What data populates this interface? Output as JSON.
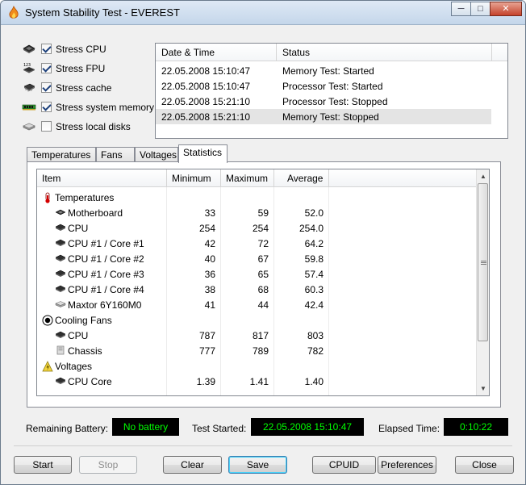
{
  "window": {
    "title": "System Stability Test - EVEREST",
    "min_label": "─",
    "max_label": "□",
    "close_label": "✕"
  },
  "stress": [
    {
      "label": "Stress CPU",
      "checked": true,
      "icon": "cpu-chip-icon"
    },
    {
      "label": "Stress FPU",
      "checked": true,
      "icon": "fpu-chip-icon"
    },
    {
      "label": "Stress cache",
      "checked": true,
      "icon": "cache-chip-icon"
    },
    {
      "label": "Stress system memory",
      "checked": true,
      "icon": "memory-module-icon"
    },
    {
      "label": "Stress local disks",
      "checked": false,
      "icon": "hard-disk-icon"
    }
  ],
  "log": {
    "columns": [
      "Date & Time",
      "Status"
    ],
    "rows": [
      [
        "22.05.2008 15:10:47",
        "Memory Test: Started"
      ],
      [
        "22.05.2008 15:10:47",
        "Processor Test: Started"
      ],
      [
        "22.05.2008 15:21:10",
        "Processor Test: Stopped"
      ],
      [
        "22.05.2008 15:21:10",
        "Memory Test: Stopped"
      ]
    ]
  },
  "tabs": [
    "Temperatures",
    "Fans",
    "Voltages",
    "Statistics"
  ],
  "active_tab": "Statistics",
  "stats": {
    "columns": [
      "Item",
      "Minimum",
      "Maximum",
      "Average"
    ],
    "rows": [
      {
        "type": "group",
        "icon": "thermometer-icon",
        "item": "Temperatures"
      },
      {
        "type": "item",
        "icon": "motherboard-icon",
        "item": "Motherboard",
        "min": "33",
        "max": "59",
        "avg": "52.0"
      },
      {
        "type": "item",
        "icon": "cpu-icon",
        "item": "CPU",
        "min": "254",
        "max": "254",
        "avg": "254.0"
      },
      {
        "type": "item",
        "icon": "cpu-icon",
        "item": "CPU #1 / Core #1",
        "min": "42",
        "max": "72",
        "avg": "64.2"
      },
      {
        "type": "item",
        "icon": "cpu-icon",
        "item": "CPU #1 / Core #2",
        "min": "40",
        "max": "67",
        "avg": "59.8"
      },
      {
        "type": "item",
        "icon": "cpu-icon",
        "item": "CPU #1 / Core #3",
        "min": "36",
        "max": "65",
        "avg": "57.4"
      },
      {
        "type": "item",
        "icon": "cpu-icon",
        "item": "CPU #1 / Core #4",
        "min": "38",
        "max": "68",
        "avg": "60.3"
      },
      {
        "type": "item",
        "icon": "hard-disk-icon",
        "item": "Maxtor 6Y160M0",
        "min": "41",
        "max": "44",
        "avg": "42.4"
      },
      {
        "type": "group",
        "icon": "fan-icon",
        "item": "Cooling Fans"
      },
      {
        "type": "item",
        "icon": "cpu-icon",
        "item": "CPU",
        "min": "787",
        "max": "817",
        "avg": "803"
      },
      {
        "type": "item",
        "icon": "chassis-icon",
        "item": "Chassis",
        "min": "777",
        "max": "789",
        "avg": "782"
      },
      {
        "type": "group",
        "icon": "voltage-warning-icon",
        "item": "Voltages"
      },
      {
        "type": "item",
        "icon": "cpu-icon",
        "item": "CPU Core",
        "min": "1.39",
        "max": "1.41",
        "avg": "1.40"
      }
    ]
  },
  "status": {
    "battery_label": "Remaining Battery:",
    "battery_value": "No battery",
    "started_label": "Test Started:",
    "started_value": "22.05.2008 15:10:47",
    "elapsed_label": "Elapsed Time:",
    "elapsed_value": "0:10:22",
    "lcd_color": "#00ff00"
  },
  "buttons": {
    "start": "Start",
    "stop": "Stop",
    "clear": "Clear",
    "save": "Save",
    "cpuid": "CPUID",
    "preferences": "Preferences",
    "close": "Close"
  }
}
